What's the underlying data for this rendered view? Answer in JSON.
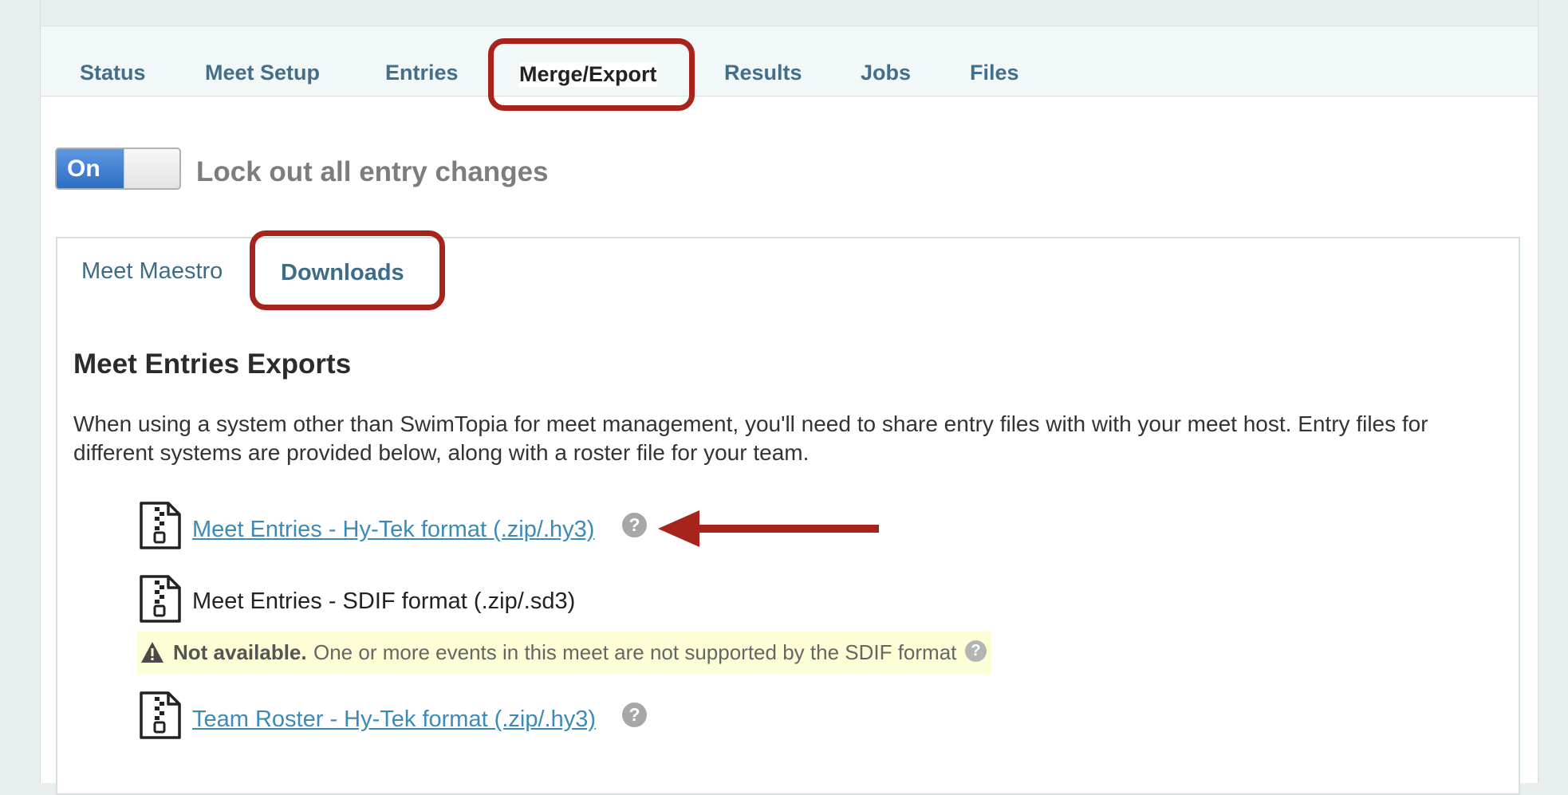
{
  "tabs": [
    {
      "label": "Status"
    },
    {
      "label": "Meet Setup"
    },
    {
      "label": "Entries"
    },
    {
      "label": "Merge/Export"
    },
    {
      "label": "Results"
    },
    {
      "label": "Jobs"
    },
    {
      "label": "Files"
    }
  ],
  "active_tab": "Merge/Export",
  "lock": {
    "toggle_state": "On",
    "label": "Lock out all entry changes"
  },
  "subtabs": [
    {
      "label": "Meet Maestro"
    },
    {
      "label": "Downloads"
    }
  ],
  "active_subtab": "Downloads",
  "exports": {
    "title": "Meet Entries Exports",
    "description": "When using a system other than SwimTopia for meet management, you'll need to share entry files with with your meet host. Entry files for different systems are provided below, along with a roster file for your team.",
    "items": [
      {
        "label": "Meet Entries - Hy-Tek format (.zip/.hy3)",
        "available": true
      },
      {
        "label": "Meet Entries - SDIF format (.zip/.sd3)",
        "available": false
      },
      {
        "label": "Team Roster - Hy-Tek format (.zip/.hy3)",
        "available": true
      }
    ],
    "warning": {
      "strong": "Not available.",
      "text": "One or more events in this meet are not supported by the SDIF format"
    }
  },
  "help_glyph": "?",
  "icons": {
    "file": "zip-file-icon",
    "help": "help-icon",
    "warning": "warning-icon",
    "annotation": "red-arrow"
  },
  "colors": {
    "annotation": "#a6241b",
    "link": "#3c8ab5",
    "tab_text": "#436f88",
    "toggle_on": "#3f7fd0",
    "warning_bg": "#fdfdd6"
  }
}
